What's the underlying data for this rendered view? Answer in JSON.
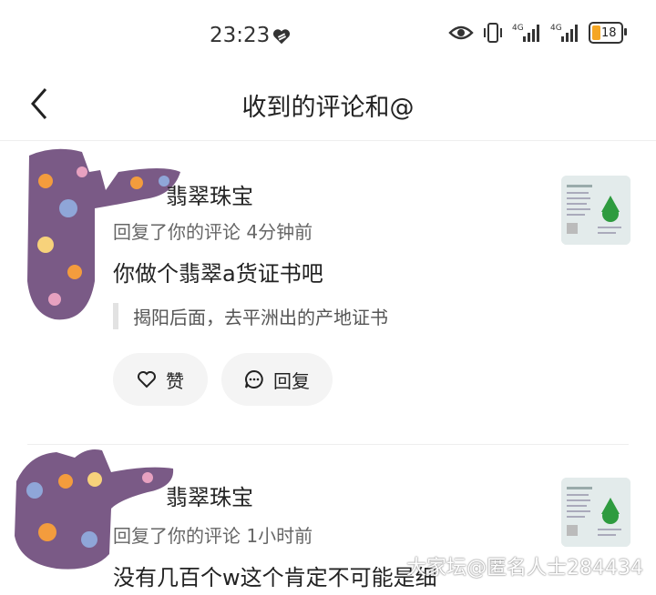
{
  "status_bar": {
    "time": "23:23",
    "battery": "18"
  },
  "nav": {
    "title": "收到的评论和@"
  },
  "notifications": [
    {
      "name": "翡翠珠宝",
      "meta": "回复了你的评论  4分钟前",
      "comment": "你做个翡翠a货证书吧",
      "quote": "揭阳后面，去平洲出的产地证书",
      "like_label": "赞",
      "reply_label": "回复"
    },
    {
      "name": "翡翠珠宝",
      "meta": "回复了你的评论  1小时前",
      "comment": "没有几百个w这个肯定不可能是细"
    }
  ],
  "watermark": "大家坛@匿名人士284434",
  "colors": {
    "avatar_purple": "#7a5a86",
    "battery_fill": "#f5a623",
    "thumb_green": "#2e9b3f"
  }
}
